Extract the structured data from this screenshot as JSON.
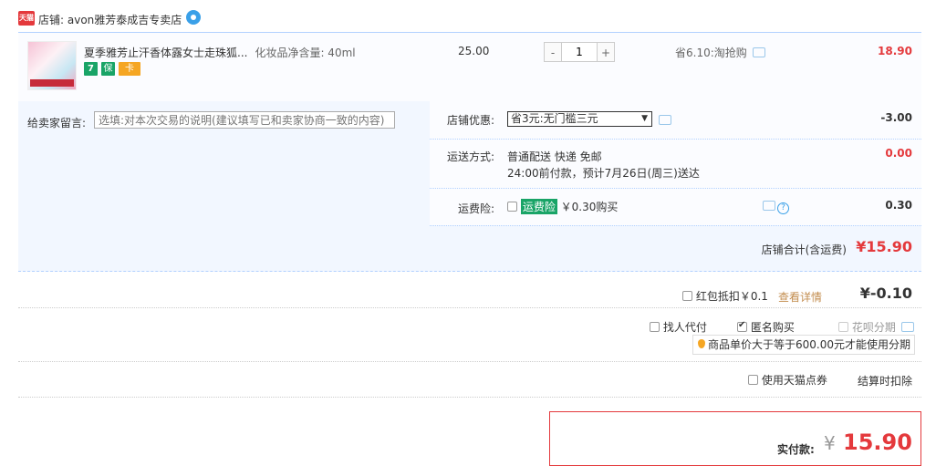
{
  "shop": {
    "badge": "天猫",
    "label": "店铺:",
    "name": "avon雅芳泰成吉专卖店"
  },
  "item": {
    "title": "夏季雅芳止汗香体露女士走珠狐...",
    "spec": "化妆品净含量: 40ml",
    "unit_price": "25.00",
    "quantity": "1",
    "minus": "-",
    "plus": "+",
    "discount": "省6.10:淘抢购",
    "subtotal": "18.90",
    "services": [
      "7",
      "保",
      "卡"
    ]
  },
  "memo": {
    "label": "给卖家留言:",
    "placeholder": "选填:对本次交易的说明(建议填写已和卖家协商一致的内容)"
  },
  "shop_promo": {
    "label": "店铺优惠:",
    "selected": "省3元:无门槛三元",
    "amount": "-3.00"
  },
  "shipping": {
    "label": "运送方式:",
    "method": "普通配送 快递 免邮",
    "eta": "24:00前付款，预计7月26日(周三)送达",
    "amount": "0.00"
  },
  "insurance": {
    "label": "运费险:",
    "tag": "运费险",
    "price": "￥0.30购买",
    "amount": "0.30"
  },
  "shop_total": {
    "label": "店铺合计(含运费)",
    "amount": "¥15.90"
  },
  "red_packet": {
    "label": "红包抵扣￥0.1",
    "link": "查看详情",
    "amount": "¥-0.10"
  },
  "options": {
    "proxy_pay": "找人代付",
    "anonymous": "匿名购买",
    "huabei": "花呗分期",
    "huabei_tip": "商品单价大于等于600.00元才能使用分期"
  },
  "points": {
    "label": "使用天猫点券",
    "note": "结算时扣除"
  },
  "payment": {
    "label": "实付款:",
    "symbol": "¥",
    "amount": "15.90"
  },
  "colors": {
    "accent_red": "#e4393c",
    "border_blue": "#b2d1ff",
    "tag_green": "#19a467"
  }
}
